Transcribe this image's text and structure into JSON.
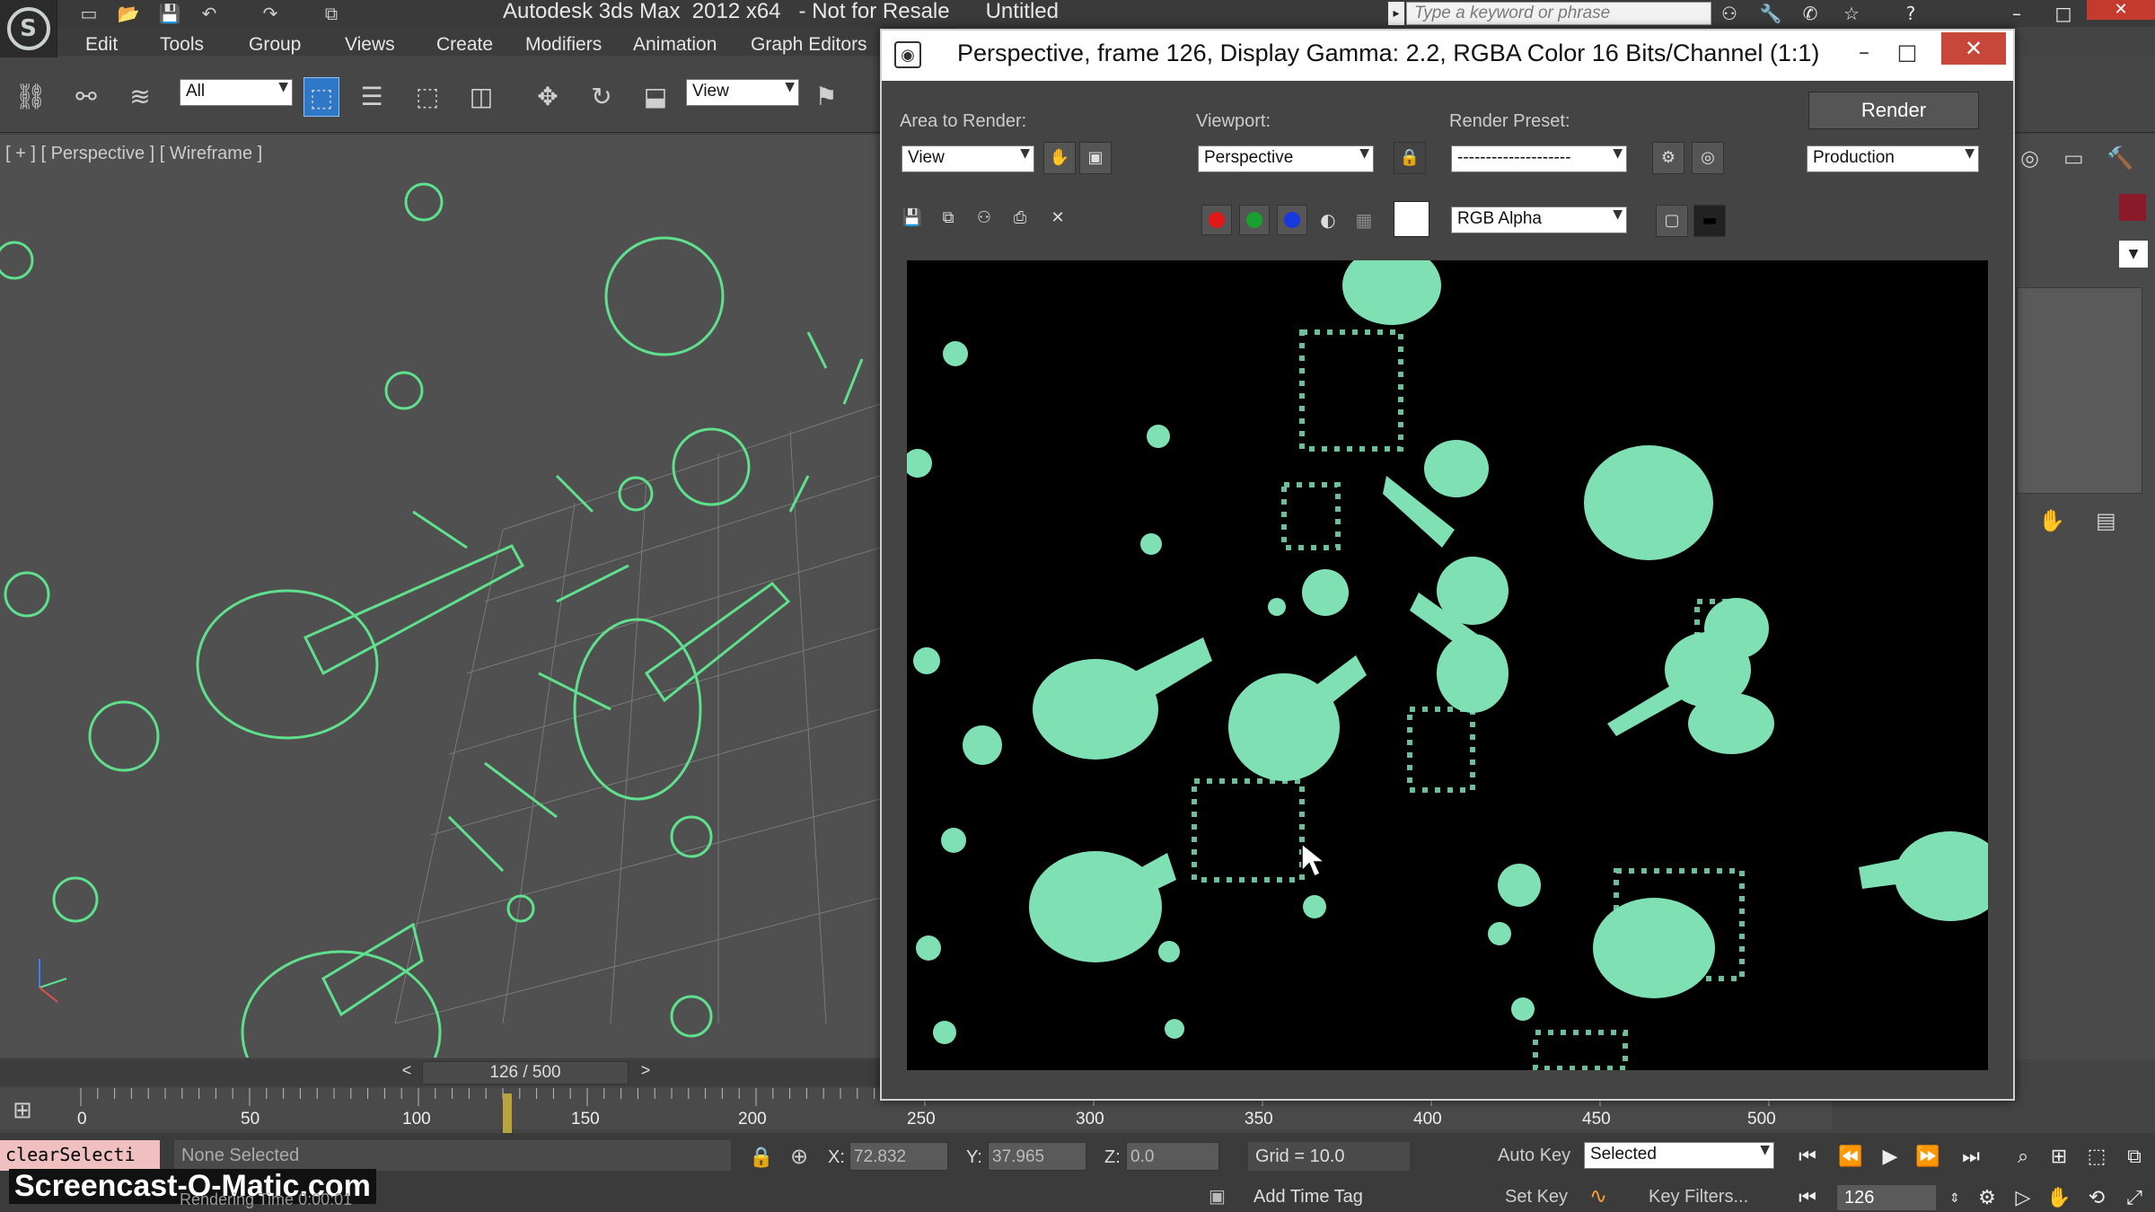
{
  "app": {
    "title_text": "Autodesk 3ds Max  2012 x64   - Not for Resale      Untitled",
    "search_placeholder": "Type a keyword or phrase",
    "logo_glyph": "S"
  },
  "menu": {
    "items": [
      "Edit",
      "Tools",
      "Group",
      "Views",
      "Create",
      "Modifiers",
      "Animation",
      "Graph Editors"
    ]
  },
  "toolbar": {
    "selection_filter": "All",
    "ref_coord": "View"
  },
  "viewport": {
    "label": "[ + ] [ Perspective ] [ Wireframe ]",
    "wire_color": "#5fe08c"
  },
  "timeline": {
    "slider_text": "126 / 500",
    "prev": "<",
    "next": ">",
    "tick_labels": [
      "0",
      "50",
      "100",
      "150",
      "200",
      "250",
      "300",
      "350",
      "400",
      "450",
      "500"
    ]
  },
  "status": {
    "maxscript": "clearSelecti",
    "selection": "None Selected",
    "x_label": "X:",
    "x_value": "72.832",
    "y_label": "Y:",
    "y_value": "37.965",
    "z_label": "Z:",
    "z_value": "0.0",
    "grid": "Grid = 10.0",
    "add_time_tag": "Add Time Tag",
    "auto_key": "Auto Key",
    "set_key": "Set Key",
    "key_mode": "Selected",
    "key_filters": "Key Filters...",
    "frame": "126",
    "render_time": "Rendering Time  0:00:01",
    "watermark": "Screencast-O-Matic.com"
  },
  "render_window": {
    "title": "Perspective, frame 126, Display Gamma: 2.2, RGBA Color 16 Bits/Channel (1:1)",
    "area_label": "Area to Render:",
    "area_value": "View",
    "viewport_label": "Viewport:",
    "viewport_value": "Perspective",
    "preset_label": "Render Preset:",
    "preset_value": "--------------------",
    "render_button": "Render",
    "mode_value": "Production",
    "channel_value": "RGB Alpha",
    "object_color": "#7fe0b4"
  }
}
